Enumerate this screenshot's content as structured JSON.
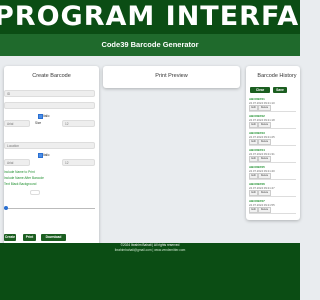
{
  "banner": {
    "text": "PROGRAM INTERFACE"
  },
  "app": {
    "title": "Code39 Barcode Generator"
  },
  "create": {
    "title": "Create Barcode",
    "field1": "ID",
    "field2": "",
    "check_label1": "Italic",
    "size_label": "Size",
    "font_value": "Arial",
    "size_value": "12",
    "field3": "Location",
    "check_label2": "Italic",
    "font_value2": "Arial",
    "size_value2": "12",
    "opt1": "Include Name to Print",
    "opt2": "Include Name After Barcode",
    "opt3": "Text Black  Background",
    "buttons": [
      "Create",
      "Print",
      "Download"
    ]
  },
  "preview": {
    "title": "Print Preview"
  },
  "history": {
    "title": "Barcode History",
    "clear_label": "Clear History",
    "save_label": "Save",
    "items": [
      {
        "code": "ABCDEF01",
        "date": "24.07.2024 09:21:10"
      },
      {
        "code": "ABCDEF02",
        "date": "24.07.2024 09:21:18"
      },
      {
        "code": "ABCDEF03",
        "date": "24.07.2024 09:21:25"
      },
      {
        "code": "ABCDEF04",
        "date": "24.07.2024 09:21:31"
      },
      {
        "code": "ABCDEF05",
        "date": "24.07.2024 09:21:40"
      },
      {
        "code": "ABCDEF06",
        "date": "24.07.2024 09:21:47"
      },
      {
        "code": "ABCDEF07",
        "date": "24.07.2024 09:21:55"
      }
    ],
    "edit_label": "Edit",
    "delete_label": "Delete"
  },
  "footer": {
    "line1": "©2024 Ibrahim Bahati | All rights reserved",
    "line2": "ibrahimbahati@gmail.com  |  www.vendemitter.com"
  },
  "colors": {
    "dark_green": "#0b4d14",
    "bar_green": "#1f6a2c",
    "accent_blue": "#2a6fd1"
  }
}
